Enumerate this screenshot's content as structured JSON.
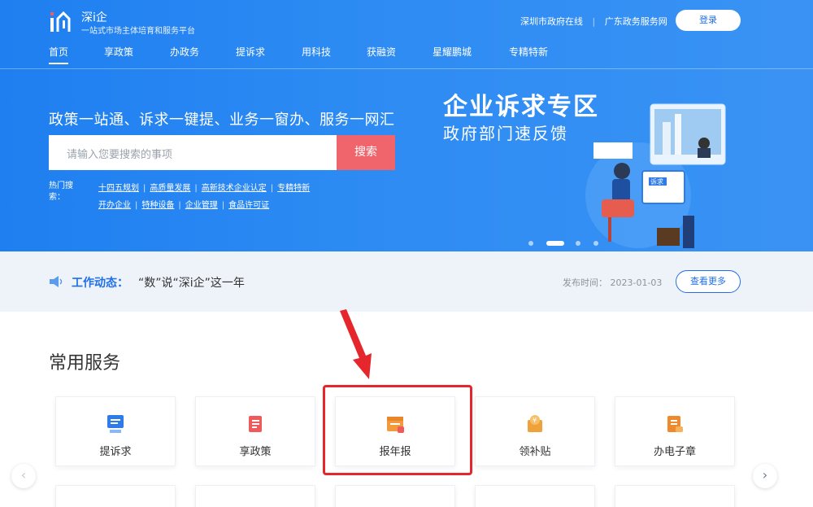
{
  "brand": {
    "title": "深i企",
    "subtitle": "一站式市场主体培育和服务平台"
  },
  "top_links": [
    "深圳市政府在线",
    "广东政务服务网"
  ],
  "login_label": "登录",
  "nav": [
    "首页",
    "享政策",
    "办政务",
    "提诉求",
    "用科技",
    "获融资",
    "星耀鹏城",
    "专精特新"
  ],
  "hero": {
    "tagline": "政策一站通、诉求一键提、业务一窗办、服务一网汇",
    "search_placeholder": "请输入您要搜索的事项",
    "search_button": "搜索",
    "hot_label": "热门搜索：",
    "hot_row1": [
      "十四五规划",
      "高质量发展",
      "高新技术企业认定",
      "专精特新"
    ],
    "hot_row2": [
      "开办企业",
      "特种设备",
      "企业管理",
      "食品许可证"
    ]
  },
  "banner": {
    "title": "企业诉求专区",
    "subtitle": "政府部门速反馈",
    "screen_text": "诉求"
  },
  "news": {
    "label": "工作动态：",
    "title": "“数”说“深i企”这一年",
    "date": "发布时间：  2023-01-03",
    "more_button": "查看更多"
  },
  "services": {
    "title": "常用服务",
    "items": [
      {
        "label": "提诉求",
        "icon": "complaint-icon",
        "color": "#2f7be8"
      },
      {
        "label": "享政策",
        "icon": "policy-icon",
        "color": "#ef5b5b"
      },
      {
        "label": "报年报",
        "icon": "annual-report-icon",
        "color": "#f39a3c"
      },
      {
        "label": "领补贴",
        "icon": "subsidy-icon",
        "color": "#f0a23a"
      },
      {
        "label": "办电子章",
        "icon": "e-seal-icon",
        "color": "#ef8a2c"
      }
    ]
  },
  "colors": {
    "primary": "#1f7ff0",
    "accent_red": "#f0656c",
    "annotation_red": "#e6262d"
  }
}
